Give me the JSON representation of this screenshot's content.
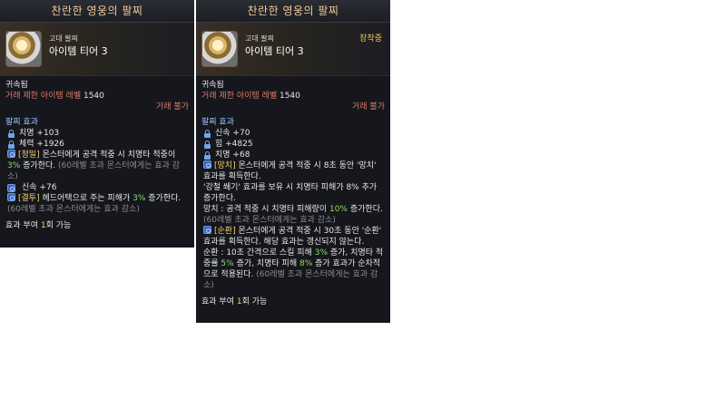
{
  "tooltips": [
    {
      "title": "찬란한 영웅의 팔찌",
      "grade": "고대 팔찌",
      "tier": "아이템 티어 3",
      "equipped": "",
      "bound": "귀속됨",
      "trade_level_label": "거래 제한 아이템 레벨",
      "trade_level_value": "1540",
      "trade_status": "거래 불가",
      "effects_title": "팔찌 효과",
      "stats": [
        "치명 +103",
        "체력 +1926"
      ],
      "effects": [
        {
          "type": "text",
          "bracket": "[정밀]",
          "parts": [
            " 몬스터에게 공격 적중 시 치명타 적중이 ",
            "3%",
            " 증가한다.",
            " (60레벨 초과 몬스터에게는 효과 감소)"
          ]
        },
        {
          "type": "stat",
          "text": "신속 +76"
        },
        {
          "type": "text",
          "bracket": "[결투]",
          "parts": [
            " 헤드어택으로 주는 피해가 ",
            "3%",
            " 증가한다.",
            " (60레벨 초과 몬스터에게는 효과 감소)"
          ]
        }
      ],
      "footer_pre": "효과 부여 ",
      "footer_num": "1",
      "footer_post": "회 가능"
    },
    {
      "title": "찬란한 영웅의 팔찌",
      "grade": "고대 팔찌",
      "tier": "아이템 티어 3",
      "equipped": "장착중",
      "bound": "귀속됨",
      "trade_level_label": "거래 제한 아이템 레벨",
      "trade_level_value": "1540",
      "trade_status": "거래 불가",
      "effects_title": "팔찌 효과",
      "stats": [
        "신속 +70",
        "힘 +4825",
        "치명 +68"
      ],
      "effect_manchi": {
        "bracket": "[망치]",
        "l1": " 몬스터에게 공격 적중 시 8초 동안 '망치' 효과를 획득한다.",
        "l2": "'강철 쐐기' 효과를 보유 시 치명타 피해가 8% 추가 증가한다.",
        "l3a": "망치 : 공격 적중 시 치명타 피해량이 ",
        "l3b": "10%",
        "l3c": " 증가한다.",
        "l3d": " (60레벨 초과 몬스터에게는 효과 감소)"
      },
      "effect_sunhwan": {
        "bracket": "[순환]",
        "l1": " 몬스터에게 공격 적중 시 30초 동안 '순환' 효과를 획득한다. 해당 효과는 갱신되지 않는다.",
        "l2a": "순환 : 10초 간격으로 스킬 피해 ",
        "l2b": "3%",
        "l2c": " 증가, 치명타 적중률 ",
        "l2d": "5%",
        "l2e": " 증가, 치명타 피해 ",
        "l2f": "8%",
        "l2g": " 증가 효과가 순차적으로 적용된다.",
        "l2h": " (60레벨 초과 몬스터에게는 효과 감소)"
      },
      "footer_pre": "효과 부여 ",
      "footer_num": "1",
      "footer_post": "회 가능"
    }
  ]
}
